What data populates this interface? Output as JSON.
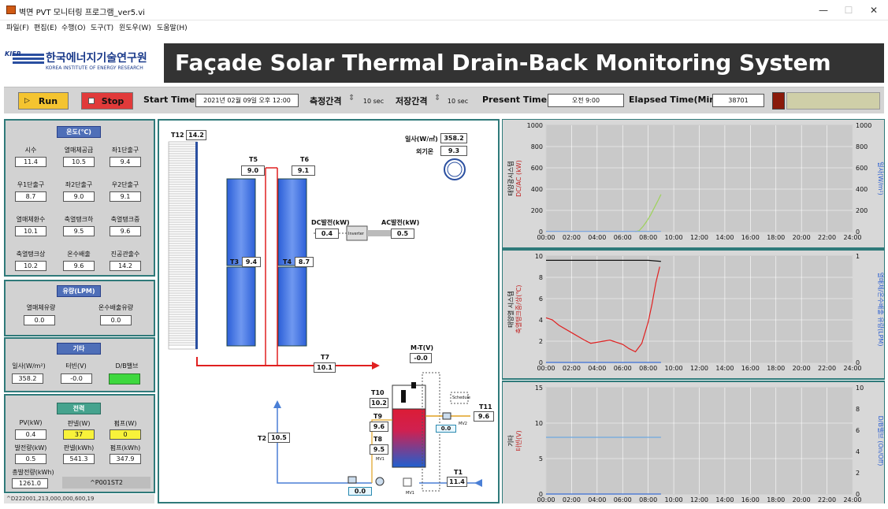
{
  "window": {
    "title": "벽면 PVT 모니터링 프로그램_ver5.vi"
  },
  "menu": [
    "파일(F)",
    "편집(E)",
    "수행(O)",
    "도구(T)",
    "윈도우(W)",
    "도움말(H)"
  ],
  "logo": {
    "abbr": "KIER",
    "name_ko": "한국에너지기술연구원",
    "name_en": "KOREA INSTITUTE OF ENERGY RESEARCH"
  },
  "banner_title": "Façade Solar Thermal Drain-Back Monitoring System",
  "toolbar": {
    "run": "Run",
    "stop": "Stop",
    "start_time_label": "Start Time",
    "start_time": "2021년 02월 09일 오후 12:00",
    "interval_label": "측정간격",
    "interval": "10 sec",
    "save_label": "저장간격",
    "save_interval": "10 sec",
    "present_label": "Present Time",
    "present": "오전 9:00",
    "elapsed_label": "Elapsed Time(Min)",
    "elapsed": "38701"
  },
  "temps": {
    "title": "온도(℃)",
    "items": [
      {
        "label": "시수",
        "value": "11.4"
      },
      {
        "label": "열매체공급",
        "value": "10.5"
      },
      {
        "label": "좌1단출구",
        "value": "9.4"
      },
      {
        "label": "우1단출구",
        "value": "8.7"
      },
      {
        "label": "좌2단출구",
        "value": "9.0"
      },
      {
        "label": "우2단출구",
        "value": "9.1"
      },
      {
        "label": "열매체환수",
        "value": "10.1"
      },
      {
        "label": "축열탱크하",
        "value": "9.5"
      },
      {
        "label": "축열탱크중",
        "value": "9.6"
      },
      {
        "label": "축열탱크상",
        "value": "10.2"
      },
      {
        "label": "온수배출",
        "value": "9.6"
      },
      {
        "label": "진공관출수",
        "value": "14.2"
      }
    ]
  },
  "flow": {
    "title": "유량(LPM)",
    "items": [
      {
        "label": "열매체유량",
        "value": "0.0"
      },
      {
        "label": "온수배출유량",
        "value": "0.0"
      }
    ]
  },
  "etc": {
    "title": "기타",
    "items": [
      {
        "label": "일사(W/m²)",
        "value": "358.2"
      },
      {
        "label": "터빈(V)",
        "value": "-0.0"
      },
      {
        "label": "D/B밸브",
        "value": ""
      }
    ]
  },
  "power": {
    "title": "전력",
    "items": [
      {
        "label": "PV(kW)",
        "value": "0.4"
      },
      {
        "label": "판넬(W)",
        "value": "37"
      },
      {
        "label": "펌프(W)",
        "value": "0"
      },
      {
        "label": "발전량(kW)",
        "value": "0.5"
      },
      {
        "label": "판넬(kWh)",
        "value": "541.3"
      },
      {
        "label": "펌프(kWh)",
        "value": "347.9"
      }
    ],
    "total_label": "총발전량(kWh)",
    "total": "1261.0",
    "code": "^P001ST2"
  },
  "status": "^D222001,213,000,000,600,19",
  "diagram": {
    "t12": {
      "label": "T12",
      "value": "14.2"
    },
    "t5": {
      "label": "T5",
      "value": "9.0"
    },
    "t6": {
      "label": "T6",
      "value": "9.1"
    },
    "t3": {
      "label": "T3",
      "value": "9.4"
    },
    "t4": {
      "label": "T4",
      "value": "8.7"
    },
    "t7": {
      "label": "T7",
      "value": "10.1"
    },
    "t2": {
      "label": "T2",
      "value": "10.5"
    },
    "t10": {
      "label": "T10",
      "value": "10.2"
    },
    "t9": {
      "label": "T9",
      "value": "9.6"
    },
    "t8": {
      "label": "T8",
      "value": "9.5"
    },
    "t11": {
      "label": "T11",
      "value": "9.6"
    },
    "t1": {
      "label": "T1",
      "value": "11.4"
    },
    "mt": {
      "label": "M-T(V)",
      "value": "-0.0"
    },
    "irr": {
      "label": "일사(W/㎡)",
      "value": "358.2"
    },
    "out": {
      "label": "외기온",
      "value": "9.3"
    },
    "dc": {
      "label": "DC발전(kW)",
      "value": "0.4"
    },
    "ac": {
      "label": "AC발전(kW)",
      "value": "0.5"
    },
    "inverter": "Inverter",
    "schedule": "Schedule",
    "flow1": "0.0",
    "flow2": "0.0",
    "mv1": "MV1",
    "mv2": "MV2",
    "mv3": "MV1"
  },
  "charts": {
    "x_ticks": [
      "00:00",
      "02:00",
      "04:00",
      "06:00",
      "08:00",
      "10:00",
      "12:00",
      "14:00",
      "16:00",
      "18:00",
      "20:00",
      "22:00",
      "24:00"
    ],
    "c1": {
      "y_ticks": [
        "0",
        "200",
        "400",
        "600",
        "800",
        "1000"
      ],
      "y2_ticks": [
        "0",
        "200",
        "400",
        "600",
        "800",
        "1000"
      ],
      "ylabel1": "태양광시스템",
      "ylabel2": "DC/AC (kW)",
      "ylabel_right": "일사(W/m²)",
      "ylabel_right_color": "#3a6fd6"
    },
    "c2": {
      "y_ticks": [
        "0",
        "2",
        "4",
        "6",
        "8",
        "10"
      ],
      "y2_ticks": [
        "0",
        "1"
      ],
      "ylabel1": "태양열 시스템",
      "ylabel2": "축열탱크중/상(℃)",
      "ylabel_right": "열매체/온수배출 유량(LPM)"
    },
    "c3": {
      "y_ticks": [
        "0",
        "5",
        "10",
        "15"
      ],
      "y2_ticks": [
        "0",
        "2",
        "4",
        "6",
        "8",
        "10"
      ],
      "ylabel1": "기타",
      "ylabel2": "터빈(V)",
      "ylabel_right": "D/B밸브 (On/Off)"
    }
  },
  "chart_data": [
    {
      "type": "line",
      "xlabel": "",
      "ylabel": "",
      "xlim": [
        0,
        24
      ],
      "ylim": [
        0,
        1000
      ],
      "series": [
        {
          "color": "#9ed25a",
          "x": [
            7.0,
            7.3,
            7.6,
            7.9,
            8.2,
            8.5,
            8.8,
            9.0
          ],
          "y": [
            0,
            10,
            50,
            100,
            160,
            230,
            300,
            350
          ]
        },
        {
          "color": "#7fa8e0",
          "x": [
            0,
            4,
            8,
            9
          ],
          "y": [
            3,
            3,
            3,
            3
          ]
        }
      ]
    },
    {
      "type": "line",
      "xlabel": "",
      "ylabel": "",
      "xlim": [
        0,
        24
      ],
      "ylim": [
        0,
        10
      ],
      "series": [
        {
          "color": "#e02020",
          "x": [
            0,
            0.5,
            1,
            2,
            3,
            3.5,
            4,
            5,
            6,
            6.5,
            7,
            7.5,
            8,
            8.3,
            8.6,
            8.9
          ],
          "y": [
            4.2,
            4.0,
            3.5,
            2.8,
            2.1,
            1.8,
            1.9,
            2.1,
            1.7,
            1.3,
            1.0,
            1.8,
            3.8,
            5.5,
            7.5,
            9.0
          ]
        },
        {
          "color": "#111111",
          "x": [
            0,
            2,
            4,
            6,
            8,
            9
          ],
          "y": [
            9.6,
            9.6,
            9.6,
            9.6,
            9.6,
            9.5
          ]
        },
        {
          "color": "#3a6fd6",
          "x": [
            0,
            9
          ],
          "y": [
            0,
            0
          ]
        }
      ]
    },
    {
      "type": "line",
      "xlabel": "",
      "ylabel": "",
      "xlim": [
        0,
        24
      ],
      "ylim": [
        0,
        15
      ],
      "series": [
        {
          "color": "#6fa8e0",
          "x": [
            0,
            9
          ],
          "y": [
            8,
            8
          ]
        },
        {
          "color": "#3a6fd6",
          "x": [
            0,
            9
          ],
          "y": [
            0,
            0
          ]
        }
      ]
    }
  ]
}
